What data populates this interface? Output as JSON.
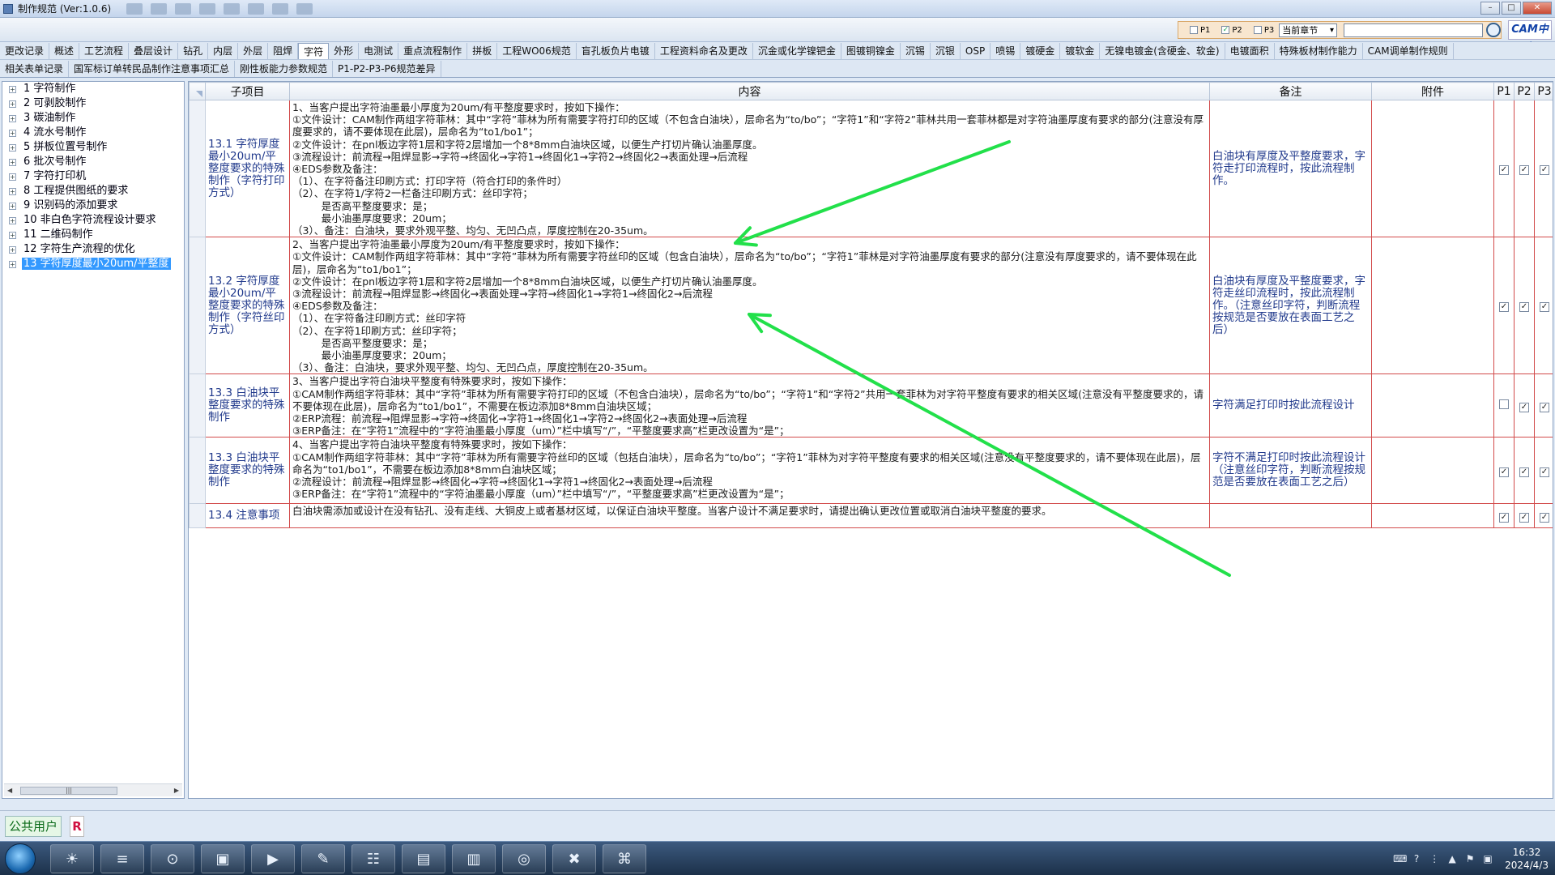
{
  "window": {
    "title": "制作规范 (Ver:1.0.6)"
  },
  "filter": {
    "p1_label": "P1",
    "p1_checked": false,
    "p2_label": "P2",
    "p2_checked": true,
    "p3_label": "P3",
    "p3_checked": false,
    "chapter_value": "当前章节",
    "search_value": ""
  },
  "brand": "CAM中心",
  "tabs_row1": [
    "更改记录",
    "概述",
    "工艺流程",
    "叠层设计",
    "钻孔",
    "内层",
    "外层",
    "阻焊",
    "字符",
    "外形",
    "电测试",
    "重点流程制作",
    "拼板",
    "工程WO06规范",
    "盲孔板负片电镀",
    "工程资料命名及更改",
    "沉金或化学镍钯金",
    "图镀铜镍金",
    "沉锡",
    "沉银",
    "OSP",
    "喷锡",
    "镀硬金",
    "镀软金",
    "无镍电镀金(含硬金、软金)",
    "电镀面积",
    "特殊板材制作能力",
    "CAM调单制作规则"
  ],
  "active_tab": "字符",
  "tabs_row2": [
    "相关表单记录",
    "国军标订单转民品制作注意事项汇总",
    "刚性板能力参数规范",
    "P1-P2-P3-P6规范差异"
  ],
  "sidebar": {
    "items": [
      {
        "label": "1  字符制作"
      },
      {
        "label": "2  可剥胶制作"
      },
      {
        "label": "3  碳油制作"
      },
      {
        "label": "4  流水号制作"
      },
      {
        "label": "5  拼板位置号制作"
      },
      {
        "label": "6  批次号制作"
      },
      {
        "label": "7  字符打印机"
      },
      {
        "label": "8  工程提供图纸的要求"
      },
      {
        "label": "9  识别码的添加要求"
      },
      {
        "label": "10  非白色字符流程设计要求"
      },
      {
        "label": "11  二维码制作"
      },
      {
        "label": "12  字符生产流程的优化"
      },
      {
        "label": "13  字符厚度最小20um/平整度"
      }
    ],
    "selected_index": 12
  },
  "grid": {
    "headers": {
      "sub": "子项目",
      "content": "内容",
      "remark": "备注",
      "attach": "附件",
      "p1": "P1",
      "p2": "P2",
      "p3": "P3"
    },
    "rows": [
      {
        "sub": "13.1 字符厚度最小20um/平整度要求的特殊制作（字符打印方式）",
        "content": "1、当客户提出字符油墨最小厚度为20um/有平整度要求时，按如下操作：\n①文件设计：CAM制作两组字符菲林：其中“字符”菲林为所有需要字符打印的区域（不包含白油块），层命名为“to/bo”；“字符1”和“字符2”菲林共用一套菲林都是对字符油墨厚度有要求的部分(注意没有厚度要求的，请不要体现在此层)，层命名为“to1/bo1”；\n②文件设计：在pnl板边字符1层和字符2层增加一个8*8mm白油块区域，以便生产打切片确认油墨厚度。\n③流程设计：前流程→阻焊显影→字符→终固化→字符1→终固化1→字符2→终固化2→表面处理→后流程\n④EDS参数及备注：\n（1）、在字符备注印刷方式：打印字符（符合打印的条件时）\n（2）、在字符1/字符2一栏备注印刷方式：丝印字符；\n         是否高平整度要求：是；\n         最小油墨厚度要求：20um；\n（3）、备注：白油块，要求外观平整、均匀、无凹凸点，厚度控制在20-35um。",
        "remark": "白油块有厚度及平整度要求，字符走打印流程时，按此流程制作。",
        "attach": "",
        "p1": true,
        "p2": true,
        "p3": true
      },
      {
        "sub": "13.2 字符厚度最小20um/平整度要求的特殊制作（字符丝印方式）",
        "content": "2、当客户提出字符油墨最小厚度为20um/有平整度要求时，按如下操作：\n①文件设计：CAM制作两组字符菲林：其中“字符”菲林为所有需要字符丝印的区域（包含白油块），层命名为“to/bo”；“字符1”菲林是对字符油墨厚度有要求的部分(注意没有厚度要求的，请不要体现在此层)，层命名为“to1/bo1”；\n②文件设计：在pnl板边字符1层和字符2层增加一个8*8mm白油块区域，以便生产打切片确认油墨厚度。\n③流程设计：前流程→阻焊显影→终固化→表面处理→字符→终固化1→字符1→终固化2→后流程\n④EDS参数及备注：\n（1）、在字符备注印刷方式：丝印字符\n（2）、在字符1印刷方式：丝印字符；\n         是否高平整度要求：是；\n         最小油墨厚度要求：20um；\n（3）、备注：白油块，要求外观平整、均匀、无凹凸点，厚度控制在20-35um。",
        "remark": "白油块有厚度及平整度要求，字符走丝印流程时，按此流程制作。（注意丝印字符，判断流程按规范是否要放在表面工艺之后）",
        "attach": "",
        "p1": true,
        "p2": true,
        "p3": true
      },
      {
        "sub": "13.3 白油块平整度要求的特殊制作",
        "content": "3、当客户提出字符白油块平整度有特殊要求时，按如下操作：\n①CAM制作两组字符菲林：其中“字符”菲林为所有需要字符打印的区域（不包含白油块），层命名为“to/bo”；“字符1”和“字符2”共用一套菲林为对字符平整度有要求的相关区域(注意没有平整度要求的，请不要体现在此层)，层命名为“to1/bo1”，不需要在板边添加8*8mm白油块区域；\n②ERP流程：前流程→阻焊显影→字符→终固化→字符1→终固化1→字符2→终固化2→表面处理→后流程\n③ERP备注：在“字符1”流程中的“字符油墨最小厚度（um）”栏中填写“/”，“平整度要求高”栏更改设置为“是”；",
        "remark": "字符满足打印时按此流程设计",
        "attach": "",
        "p1": false,
        "p2": true,
        "p3": true
      },
      {
        "sub": "13.3 白油块平整度要求的特殊制作",
        "content": "4、当客户提出字符白油块平整度有特殊要求时，按如下操作：\n①CAM制作两组字符菲林：其中“字符”菲林为所有需要字符丝印的区域（包括白油块），层命名为“to/bo”；“字符1”菲林为对字符平整度有要求的相关区域(注意没有平整度要求的，请不要体现在此层)，层命名为“to1/bo1”，不需要在板边添加8*8mm白油块区域；\n②流程设计：前流程→阻焊显影→终固化→字符→终固化1→字符1→终固化2→表面处理→后流程\n③ERP备注：在“字符1”流程中的“字符油墨最小厚度（um）”栏中填写“/”，“平整度要求高”栏更改设置为“是”；",
        "remark": "字符不满足打印时按此流程设计（注意丝印字符，判断流程按规范是否要放在表面工艺之后）",
        "attach": "",
        "p1": true,
        "p2": true,
        "p3": true
      },
      {
        "sub": "13.4 注意事项",
        "content": "白油块需添加或设计在没有钻孔、没有走线、大铜皮上或者基材区域，以保证白油块平整度。当客户设计不满足要求时，请提出确认更改位置或取消白油块平整度的要求。",
        "remark": "",
        "attach": "",
        "p1": true,
        "p2": true,
        "p3": true
      }
    ]
  },
  "annotation_color": "#22e04a",
  "status": {
    "user": "公共用户",
    "badge": "R"
  },
  "taskbar": {
    "apps": [
      "shell-icon",
      "notepad-icon",
      "browser-icon",
      "save-disk-icon",
      "publisher-icon",
      "pen-icon",
      "excel-icon",
      "word-icon",
      "book-icon",
      "viewer-icon",
      "tool-icon",
      "network-icon"
    ],
    "time": "16:32",
    "date": "2024/4/3"
  }
}
